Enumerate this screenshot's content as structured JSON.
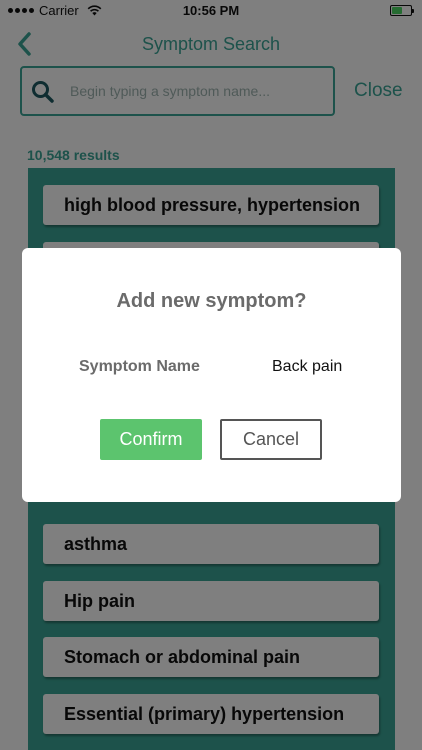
{
  "status_bar": {
    "carrier": "Carrier",
    "time": "10:56 PM",
    "icons": [
      "signal-dots",
      "wifi-icon",
      "battery-icon"
    ]
  },
  "nav": {
    "title": "Symptom Search",
    "back_icon": "chevron-left-icon"
  },
  "search": {
    "placeholder": "Begin typing a symptom name...",
    "value": "",
    "icon": "search-icon",
    "close_label": "Close"
  },
  "results": {
    "count_label": "10,548 results",
    "items": [
      {
        "label": "high blood pressure, hypertension"
      },
      {
        "label": ""
      },
      {
        "label": ""
      },
      {
        "label": ""
      },
      {
        "label": ""
      },
      {
        "label": "asthma"
      },
      {
        "label": "Hip pain"
      },
      {
        "label": "Stomach or abdominal pain"
      },
      {
        "label": "Essential (primary) hypertension"
      }
    ]
  },
  "dialog": {
    "title": "Add new symptom?",
    "field_label": "Symptom Name",
    "field_value": "Back pain",
    "confirm_label": "Confirm",
    "cancel_label": "Cancel"
  },
  "colors": {
    "accent": "#3aa596",
    "confirm": "#5cc46e",
    "overlay": "rgba(0,0,0,0.5)"
  }
}
